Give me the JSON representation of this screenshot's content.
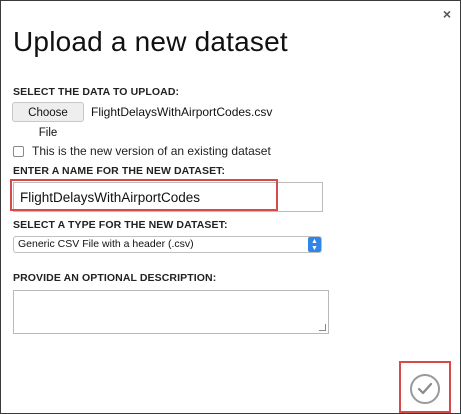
{
  "dialog": {
    "title": "Upload a new dataset",
    "close_glyph": "×"
  },
  "upload": {
    "label": "SELECT THE DATA TO UPLOAD:",
    "choose_file_label": "Choose File",
    "file_name": "FlightDelaysWithAirportCodes.csv"
  },
  "version_checkbox": {
    "label": "This is the new version of an existing dataset",
    "checked": false
  },
  "name_field": {
    "label": "ENTER A NAME FOR THE NEW DATASET:",
    "value": "FlightDelaysWithAirportCodes"
  },
  "type_field": {
    "label": "SELECT A TYPE FOR THE NEW DATASET:",
    "selected": "Generic CSV File with a header (.csv)"
  },
  "description_field": {
    "label": "PROVIDE AN OPTIONAL DESCRIPTION:",
    "value": ""
  },
  "icons": {
    "close": "close-icon",
    "ok": "checkmark-icon",
    "select": "chevron-up-down-icon"
  },
  "colors": {
    "highlight": "#d64a4a",
    "select_accent": "#2f86e8"
  }
}
